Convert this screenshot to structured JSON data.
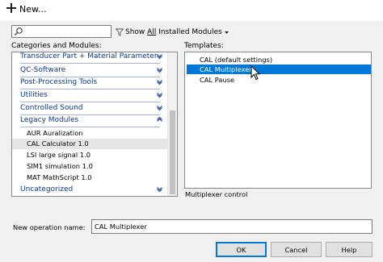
{
  "window": {
    "title": "New...",
    "icon": "plus-icon"
  },
  "search": {
    "value": "",
    "icon": "search-icon"
  },
  "filter": {
    "prefix": "Show ",
    "underlined": "All",
    "suffix": " Installed Modules",
    "icon": "funnel-icon"
  },
  "labels": {
    "categories": "Categories and Modules:",
    "templates": "Templates:",
    "new_name": "New operation name:"
  },
  "categories": [
    {
      "label": "Transducer Part + Material Parameter",
      "expanded": false
    },
    {
      "label": "QC-Software",
      "expanded": false
    },
    {
      "label": "Post-Processing Tools",
      "expanded": false
    },
    {
      "label": "Utilities",
      "expanded": false
    },
    {
      "label": "Controlled Sound",
      "expanded": false
    },
    {
      "label": "Legacy Modules",
      "expanded": true,
      "children": [
        "AUR Auralization",
        "CAL Calculator 1.0",
        "LSI large signal 1.0",
        "SIM1 simulation 1.0",
        "MAT MathScript 1.0"
      ]
    },
    {
      "label": "Uncategorized",
      "expanded": false
    }
  ],
  "selected_module": "CAL Calculator 1.0",
  "templates": [
    "CAL (default settings)",
    "CAL Multiplexer",
    "CAL Pause"
  ],
  "selected_template": "CAL Multiplexer",
  "template_description": "Multiplexer control",
  "new_operation_name": "CAL Multiplexer",
  "buttons": {
    "ok": "OK",
    "cancel": "Cancel",
    "help": "Help"
  },
  "colors": {
    "accent": "#0078d7",
    "category_text": "#0b3a9c"
  }
}
